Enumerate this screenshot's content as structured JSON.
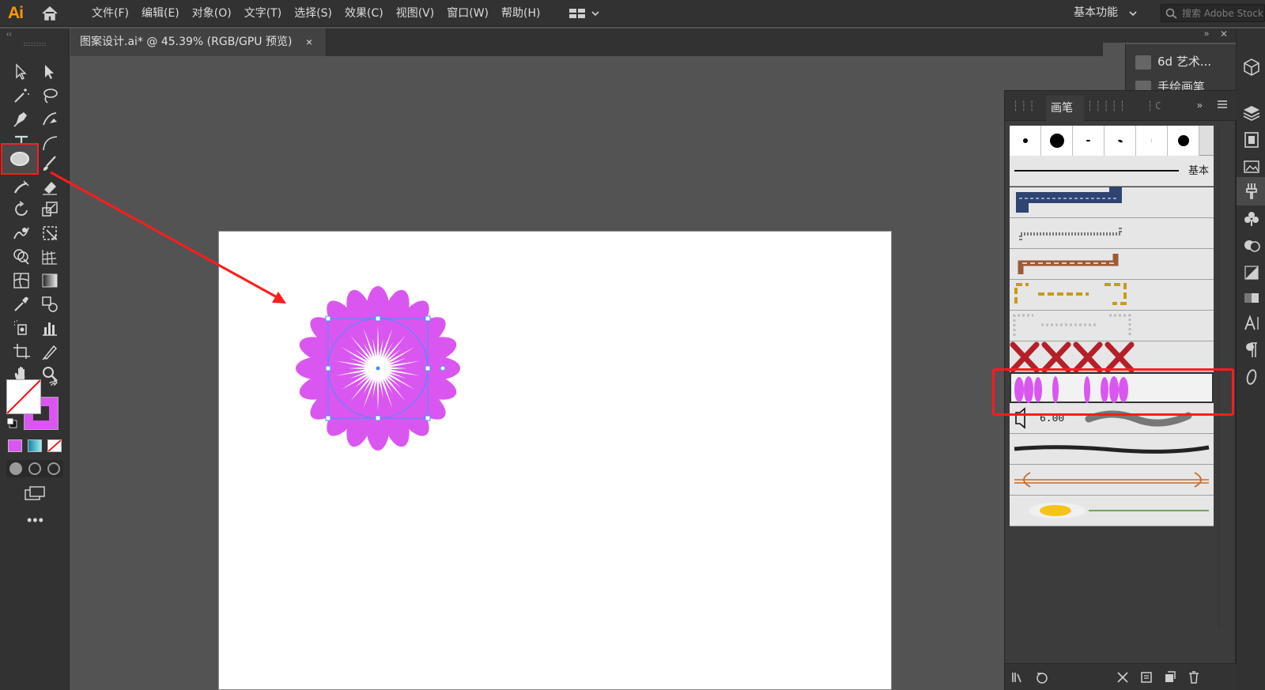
{
  "app": {
    "logo_text": "Ai",
    "menu": [
      "文件(F)",
      "编辑(E)",
      "对象(O)",
      "文字(T)",
      "选择(S)",
      "效果(C)",
      "视图(V)",
      "窗口(W)",
      "帮助(H)"
    ],
    "workspace_label": "基本功能",
    "search_placeholder": "搜索 Adobe Stock"
  },
  "document": {
    "tab_title": "图案设计.ai* @ 45.39% (RGB/GPU 预览)",
    "close_glyph": "×"
  },
  "libraries_panel": {
    "items": [
      "6d 艺术...",
      "手绘画笔"
    ]
  },
  "brushes_panel": {
    "active_tab": "画笔",
    "expand_glyph": "»",
    "basic_brush_label": "基本",
    "selected_brush": "flower-petal-pattern-brush",
    "size_value": "6.00"
  },
  "colors": {
    "accent_flower": "#d957f0",
    "selection_blue": "#4a8cff",
    "annotation_red": "#ff1c1c",
    "fill_swatch": "#ffffff",
    "stroke_swatch": "#d957f0"
  }
}
